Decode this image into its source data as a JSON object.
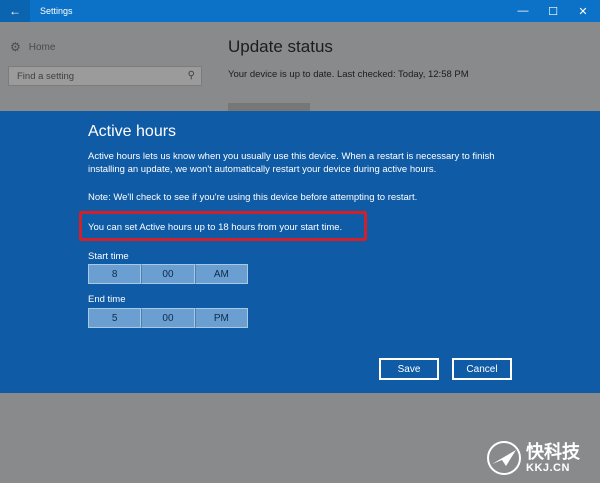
{
  "window": {
    "title": "Settings",
    "controls": {
      "minimize": "—",
      "maximize": "☐",
      "close": "✕"
    }
  },
  "sidebar": {
    "home_label": "Home",
    "search_placeholder": "Find a setting"
  },
  "main": {
    "heading": "Update status",
    "status_text": "Your device is up to date. Last checked: Today, 12:58 PM"
  },
  "dialog": {
    "title": "Active hours",
    "description": "Active hours lets us know when you usually use this device. When a restart is necessary to finish installing an update, we won't automatically restart your device during active hours.",
    "note": "Note: We'll check to see if you're using this device before attempting to restart.",
    "hint": "You can set Active hours up to 18 hours from your start time.",
    "start_time": {
      "label": "Start time",
      "hour": "8",
      "minute": "00",
      "period": "AM"
    },
    "end_time": {
      "label": "End time",
      "hour": "5",
      "minute": "00",
      "period": "PM"
    },
    "save_label": "Save",
    "cancel_label": "Cancel"
  },
  "watermark": {
    "cn": "快科技",
    "en": "KKJ.CN"
  },
  "colors": {
    "titlebar": "#0c72c7",
    "dialog_bg": "#0f5ba6",
    "highlight": "#d0212b",
    "picker_bg": "#6c9fd1"
  }
}
